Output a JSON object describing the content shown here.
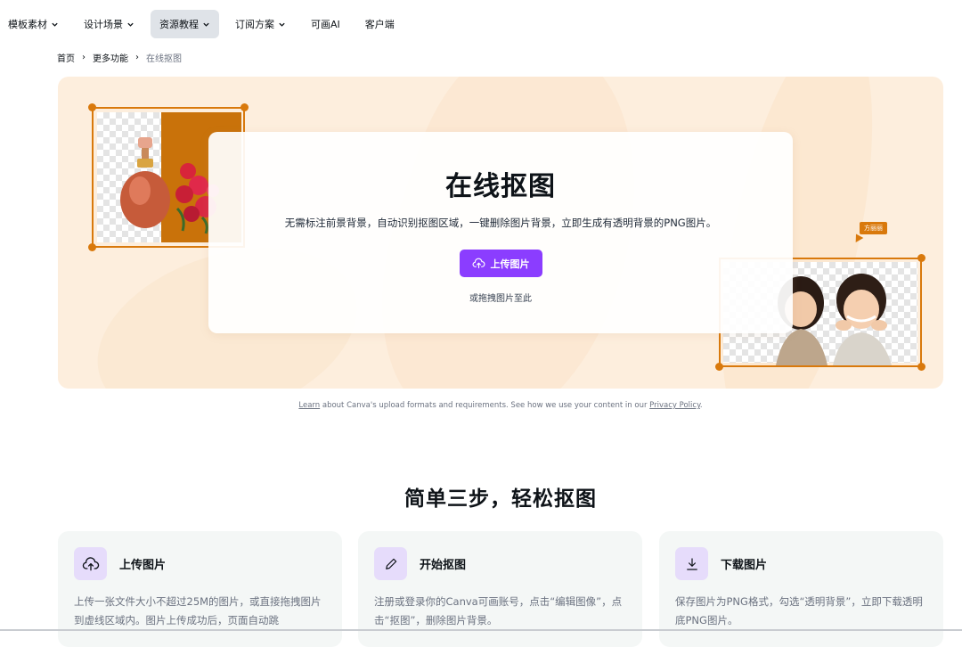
{
  "nav": {
    "items": [
      {
        "label": "模板素材",
        "dropdown": true,
        "active": false
      },
      {
        "label": "设计场景",
        "dropdown": true,
        "active": false
      },
      {
        "label": "资源教程",
        "dropdown": true,
        "active": true
      },
      {
        "label": "订阅方案",
        "dropdown": true,
        "active": false
      },
      {
        "label": "可画AI",
        "dropdown": false,
        "active": false
      },
      {
        "label": "客户端",
        "dropdown": false,
        "active": false
      }
    ]
  },
  "breadcrumb": {
    "items": [
      "首页",
      "更多功能"
    ],
    "current": "在线抠图",
    "separator": "›"
  },
  "hero": {
    "title": "在线抠图",
    "subtitle": "无需标注前景背景，自动识别抠图区域，一键删除图片背景，立即生成有透明背景的PNG图片。",
    "upload_label": "上传图片",
    "drag_text": "或拖拽图片至此",
    "tag_label": "方丽丽",
    "accent_color": "#8b3dff",
    "frame_color": "#d9790c"
  },
  "privacy": {
    "learn": "Learn",
    "middle": " about Canva's upload formats and requirements. See how we use your content in our ",
    "policy": "Privacy Policy",
    "end": "."
  },
  "steps": {
    "title": "简单三步，轻松抠图",
    "items": [
      {
        "icon": "cloud-upload-icon",
        "title": "上传图片",
        "desc": "上传一张文件大小不超过25M的图片，或直接拖拽图片到虚线区域内。图片上传成功后，页面自动跳"
      },
      {
        "icon": "pencil-icon",
        "title": "开始抠图",
        "desc": "注册或登录你的Canva可画账号，点击“编辑图像”，点击“抠图”，删除图片背景。"
      },
      {
        "icon": "download-icon",
        "title": "下载图片",
        "desc": "保存图片为PNG格式，勾选“透明背景”，立即下载透明底PNG图片。"
      }
    ]
  }
}
